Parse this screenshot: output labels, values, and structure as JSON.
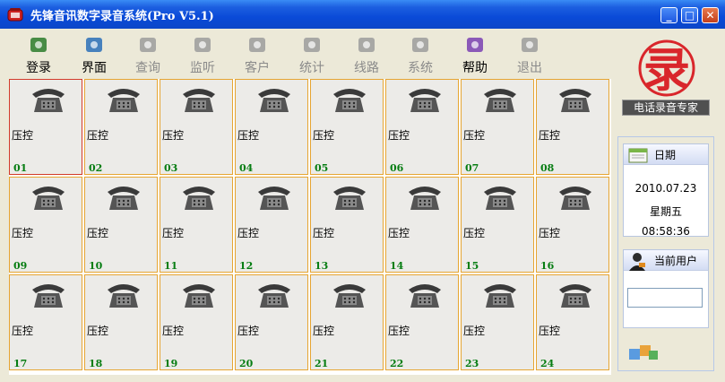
{
  "window": {
    "title": "先锋音讯数字录音系统(Pro V5.1)",
    "minimize": "_",
    "maximize": "□",
    "close": "✕"
  },
  "toolbar": [
    {
      "label": "登录",
      "icon": "login-icon",
      "enabled": true
    },
    {
      "label": "界面",
      "icon": "interface-icon",
      "enabled": true
    },
    {
      "label": "查询",
      "icon": "query-icon",
      "enabled": false
    },
    {
      "label": "监听",
      "icon": "monitor-icon",
      "enabled": false
    },
    {
      "label": "客户",
      "icon": "customer-icon",
      "enabled": false
    },
    {
      "label": "统计",
      "icon": "statistics-icon",
      "enabled": false
    },
    {
      "label": "线路",
      "icon": "line-icon",
      "enabled": false
    },
    {
      "label": "系统",
      "icon": "system-icon",
      "enabled": false
    },
    {
      "label": "帮助",
      "icon": "help-icon",
      "enabled": true
    },
    {
      "label": "退出",
      "icon": "exit-icon",
      "enabled": false
    }
  ],
  "channels": [
    {
      "status": "压控",
      "id": "01"
    },
    {
      "status": "压控",
      "id": "02"
    },
    {
      "status": "压控",
      "id": "03"
    },
    {
      "status": "压控",
      "id": "04"
    },
    {
      "status": "压控",
      "id": "05"
    },
    {
      "status": "压控",
      "id": "06"
    },
    {
      "status": "压控",
      "id": "07"
    },
    {
      "status": "压控",
      "id": "08"
    },
    {
      "status": "压控",
      "id": "09"
    },
    {
      "status": "压控",
      "id": "10"
    },
    {
      "status": "压控",
      "id": "11"
    },
    {
      "status": "压控",
      "id": "12"
    },
    {
      "status": "压控",
      "id": "13"
    },
    {
      "status": "压控",
      "id": "14"
    },
    {
      "status": "压控",
      "id": "15"
    },
    {
      "status": "压控",
      "id": "16"
    },
    {
      "status": "压控",
      "id": "17"
    },
    {
      "status": "压控",
      "id": "18"
    },
    {
      "status": "压控",
      "id": "19"
    },
    {
      "status": "压控",
      "id": "20"
    },
    {
      "status": "压控",
      "id": "21"
    },
    {
      "status": "压控",
      "id": "22"
    },
    {
      "status": "压控",
      "id": "23"
    },
    {
      "status": "压控",
      "id": "24"
    }
  ],
  "selected_channel": "01",
  "brand": {
    "caption": "电话录音专家",
    "logo_char": "录"
  },
  "date_panel": {
    "title": "日期",
    "date": "2010.07.23",
    "weekday": "星期五",
    "time": "08:58:36"
  },
  "user_panel": {
    "title": "当前用户",
    "value": ""
  },
  "colors": {
    "titlebar": "#0a4ad8",
    "cell_border": "#e6a532",
    "selected_border": "#d23b2a",
    "channel_number": "#067d12",
    "logo": "#d9262b"
  }
}
